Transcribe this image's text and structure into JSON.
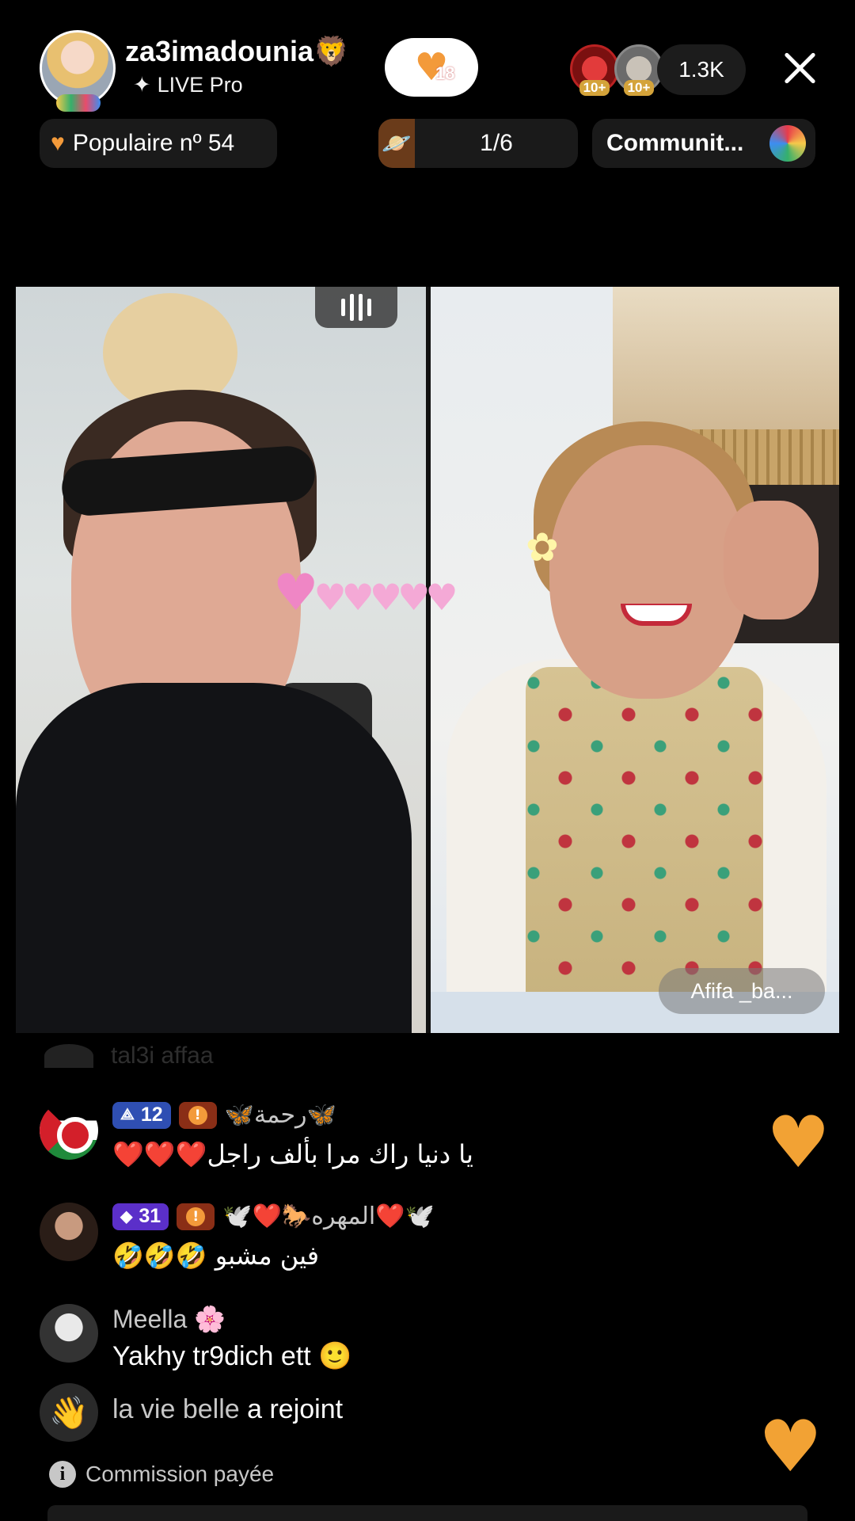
{
  "header": {
    "host_name": "za3imadounia",
    "host_suffix_emoji": "🦁",
    "host_subtitle": "LIVE Pro",
    "follow_count": "18",
    "viewer_badges": [
      "10+",
      "10+"
    ],
    "viewer_count": "1.3K"
  },
  "chips": {
    "popular_label": "Populaire nº 54",
    "rank_label": "1/6",
    "community_label": "Communit..."
  },
  "video": {
    "guest_name": "Afifa _ba..."
  },
  "chat": {
    "faded_name": "tal3i affaa",
    "messages": [
      {
        "level": "12",
        "username": "🦋رحمة🦋",
        "text": "يا دنيا راك مرا بألف راجل❤️❤️❤️"
      },
      {
        "level": "31",
        "username": "🕊️❤️🐎المهره❤️🕊️",
        "text": "فين مشبو 🤣🤣🤣"
      },
      {
        "username": "Meella 🌸",
        "text": "Yakhy tr9dich ett 🙂"
      }
    ],
    "join": {
      "who": "la vie belle",
      "action": "a rejoint"
    },
    "commission": "Commission payée"
  },
  "colors": {
    "accent_orange": "#f39a3a",
    "level_blue": "#2f4fb3",
    "level_purple": "#5b2fc9",
    "heart_pink": "#f4a9d6"
  }
}
